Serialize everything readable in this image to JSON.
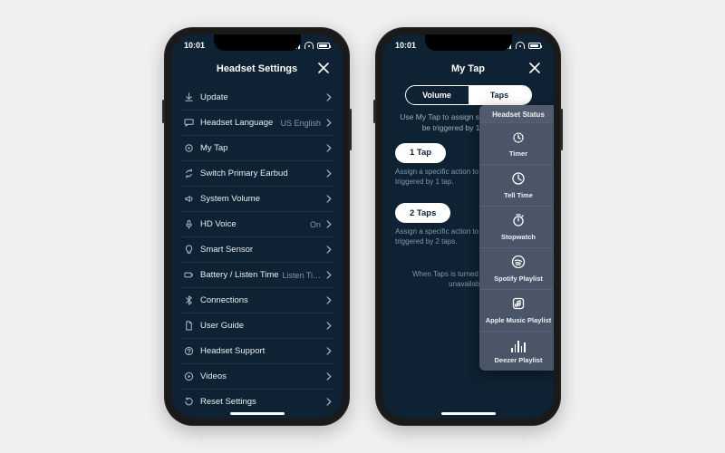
{
  "statusbar": {
    "time": "10:01"
  },
  "left": {
    "title": "Headset Settings",
    "rows": [
      {
        "icon": "download",
        "label": "Update",
        "value": ""
      },
      {
        "icon": "chat",
        "label": "Headset Language",
        "value": "US English"
      },
      {
        "icon": "target",
        "label": "My Tap",
        "value": ""
      },
      {
        "icon": "swap",
        "label": "Switch Primary Earbud",
        "value": ""
      },
      {
        "icon": "speaker",
        "label": "System Volume",
        "value": ""
      },
      {
        "icon": "mic",
        "label": "HD Voice",
        "value": "On"
      },
      {
        "icon": "bulb",
        "label": "Smart Sensor",
        "value": ""
      },
      {
        "icon": "battery",
        "label": "Battery / Listen Time",
        "value": "Listen Ti…"
      },
      {
        "icon": "bluetooth",
        "label": "Connections",
        "value": ""
      },
      {
        "icon": "doc",
        "label": "User Guide",
        "value": ""
      },
      {
        "icon": "support",
        "label": "Headset Support",
        "value": ""
      },
      {
        "icon": "play",
        "label": "Videos",
        "value": ""
      },
      {
        "icon": "reset",
        "label": "Reset Settings",
        "value": ""
      }
    ]
  },
  "right": {
    "title": "My Tap",
    "segments": {
      "a": "Volume",
      "b": "Taps",
      "active": "b"
    },
    "intro": "Use My Tap to assign specific actions to be triggered by 1 or 2 taps.",
    "tap1": {
      "label": "1 Tap",
      "desc": "Assign a specific action to be triggered by 1 tap."
    },
    "tap2": {
      "label": "2 Taps",
      "desc": "Assign a specific action to be triggered by 2 taps."
    },
    "footnote": "When Taps is turned on, Volume is unavailable.",
    "panel": {
      "header": "Headset Status",
      "items": [
        {
          "icon": "timer",
          "label": "Timer"
        },
        {
          "icon": "clock",
          "label": "Tell Time"
        },
        {
          "icon": "stopwatch",
          "label": "Stopwatch"
        },
        {
          "icon": "spotify",
          "label": "Spotify Playlist"
        },
        {
          "icon": "applemusic",
          "label": "Apple Music Playlist"
        },
        {
          "icon": "deezer",
          "label": "Deezer Playlist"
        }
      ]
    }
  }
}
